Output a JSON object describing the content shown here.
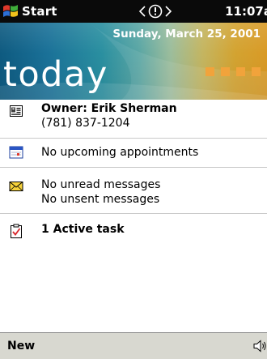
{
  "titlebar": {
    "start_label": "Start",
    "clock": "11:07a",
    "start_icon": "windows-flag-icon",
    "nav_icon": "navigation-arrows-icon"
  },
  "banner": {
    "date": "Sunday, March 25, 2001",
    "title": "today",
    "square_color": "#f1a33b"
  },
  "items": {
    "owner": {
      "icon": "owner-card-icon",
      "name": "Owner: Erik Sherman",
      "phone": "(781) 837-1204"
    },
    "calendar": {
      "icon": "calendar-icon",
      "text": "No upcoming appointments"
    },
    "messages": {
      "icon": "envelope-icon",
      "line1": "No unread messages",
      "line2": "No unsent messages"
    },
    "tasks": {
      "icon": "task-clipboard-icon",
      "text": "1 Active task"
    }
  },
  "commandbar": {
    "new_label": "New",
    "speaker_icon": "speaker-icon"
  },
  "colors": {
    "titlebar_bg": "#0a0a0a",
    "commandbar_bg": "#d8d8d0",
    "divider": "#c9c9c9"
  }
}
